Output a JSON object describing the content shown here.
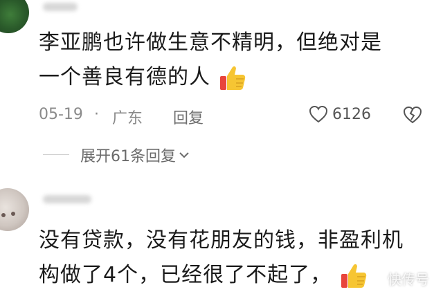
{
  "comments": [
    {
      "line1": "李亚鹏也许做生意不精明，但绝对是",
      "line2": "一个善良有德的人",
      "date": "05-19",
      "separator": "·",
      "location": "广东",
      "reply_label": "回复",
      "likes": "6126",
      "expand_label": "展开61条回复"
    },
    {
      "line1": "没有贷款，没有花朋友的钱，非盈利机",
      "line2": "构做了4个，已经很了不起了，"
    }
  ],
  "watermark": "快传号",
  "icons": {
    "heart": "heart-outline-icon",
    "dislike": "broken-heart-icon",
    "chevron": "chevron-down-icon",
    "thumbs": "thumbs-up-emoji"
  },
  "colors": {
    "text": "#1a1a1a",
    "meta": "#8a8a8a",
    "thumb_yellow": "#f6c533",
    "thumb_red": "#e8453c"
  }
}
